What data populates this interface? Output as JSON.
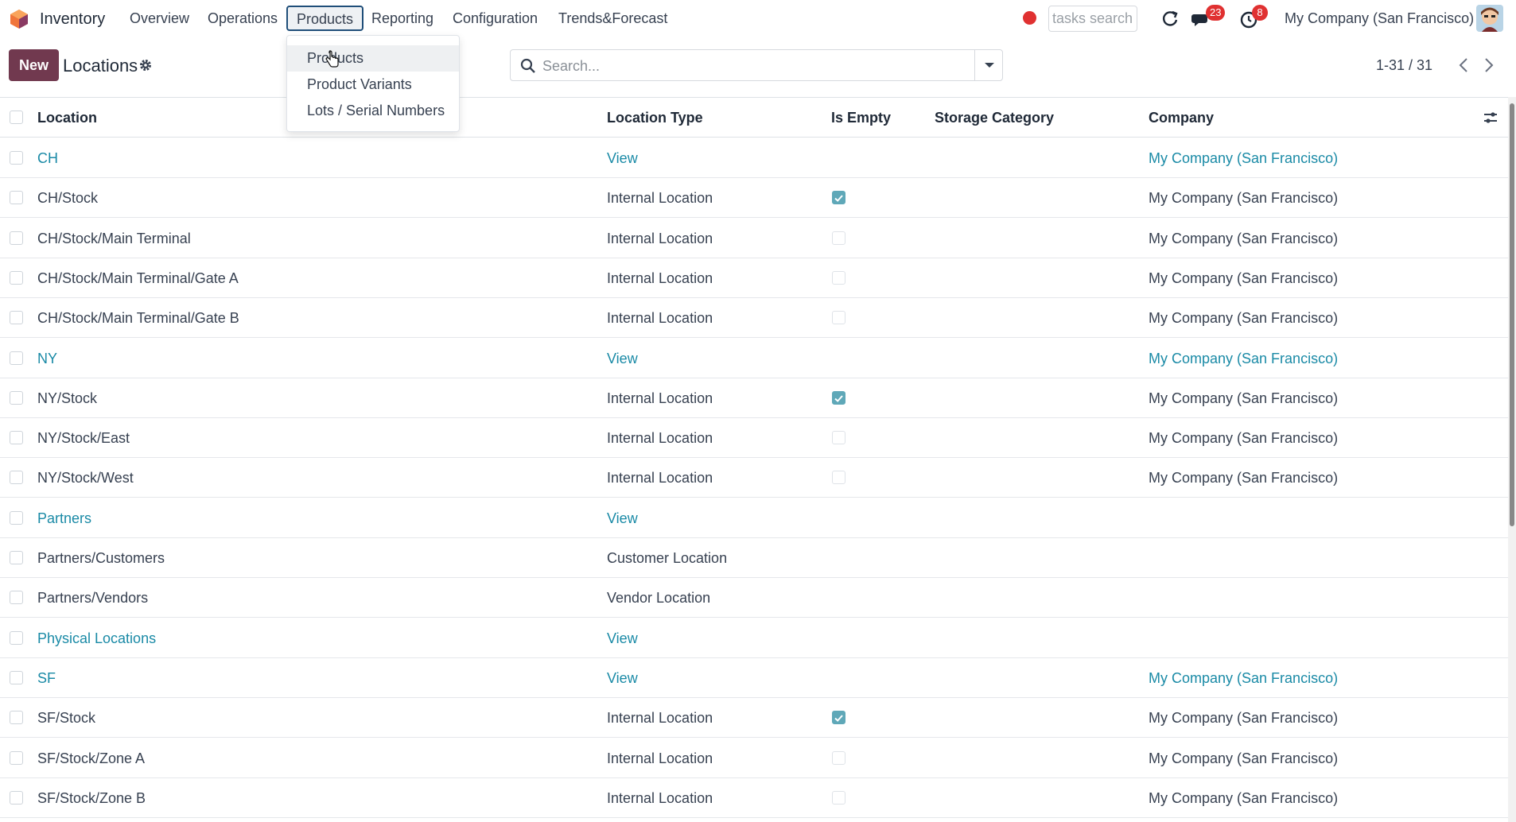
{
  "navbar": {
    "app_name": "Inventory",
    "menus": [
      "Overview",
      "Operations",
      "Products",
      "Reporting",
      "Configuration",
      "Trends&Forecast"
    ],
    "active_menu": "Products",
    "tasks_search_placeholder": "tasks search",
    "messages_badge": "23",
    "activities_badge": "8",
    "company": "My Company (San Francisco)"
  },
  "control_panel": {
    "new_label": "New",
    "title": "Locations",
    "search_placeholder": "Search...",
    "pager": "1-31 / 31"
  },
  "dropdown": {
    "items": [
      "Products",
      "Product Variants",
      "Lots / Serial Numbers"
    ],
    "hovered": "Products"
  },
  "table": {
    "columns": [
      "Location",
      "Location Type",
      "Is Empty",
      "Storage Category",
      "Company"
    ],
    "rows": [
      {
        "location": "CH",
        "type": "View",
        "is_empty": null,
        "storage": "",
        "company": "My Company (San Francisco)",
        "view": true
      },
      {
        "location": "CH/Stock",
        "type": "Internal Location",
        "is_empty": true,
        "storage": "",
        "company": "My Company (San Francisco)",
        "view": false
      },
      {
        "location": "CH/Stock/Main Terminal",
        "type": "Internal Location",
        "is_empty": false,
        "storage": "",
        "company": "My Company (San Francisco)",
        "view": false
      },
      {
        "location": "CH/Stock/Main Terminal/Gate A",
        "type": "Internal Location",
        "is_empty": false,
        "storage": "",
        "company": "My Company (San Francisco)",
        "view": false
      },
      {
        "location": "CH/Stock/Main Terminal/Gate B",
        "type": "Internal Location",
        "is_empty": false,
        "storage": "",
        "company": "My Company (San Francisco)",
        "view": false
      },
      {
        "location": "NY",
        "type": "View",
        "is_empty": null,
        "storage": "",
        "company": "My Company (San Francisco)",
        "view": true
      },
      {
        "location": "NY/Stock",
        "type": "Internal Location",
        "is_empty": true,
        "storage": "",
        "company": "My Company (San Francisco)",
        "view": false
      },
      {
        "location": "NY/Stock/East",
        "type": "Internal Location",
        "is_empty": false,
        "storage": "",
        "company": "My Company (San Francisco)",
        "view": false
      },
      {
        "location": "NY/Stock/West",
        "type": "Internal Location",
        "is_empty": false,
        "storage": "",
        "company": "My Company (San Francisco)",
        "view": false
      },
      {
        "location": "Partners",
        "type": "View",
        "is_empty": null,
        "storage": "",
        "company": "",
        "view": true
      },
      {
        "location": "Partners/Customers",
        "type": "Customer Location",
        "is_empty": null,
        "storage": "",
        "company": "",
        "view": false
      },
      {
        "location": "Partners/Vendors",
        "type": "Vendor Location",
        "is_empty": null,
        "storage": "",
        "company": "",
        "view": false
      },
      {
        "location": "Physical Locations",
        "type": "View",
        "is_empty": null,
        "storage": "",
        "company": "",
        "view": true
      },
      {
        "location": "SF",
        "type": "View",
        "is_empty": null,
        "storage": "",
        "company": "My Company (San Francisco)",
        "view": true
      },
      {
        "location": "SF/Stock",
        "type": "Internal Location",
        "is_empty": true,
        "storage": "",
        "company": "My Company (San Francisco)",
        "view": false
      },
      {
        "location": "SF/Stock/Zone A",
        "type": "Internal Location",
        "is_empty": false,
        "storage": "",
        "company": "My Company (San Francisco)",
        "view": false
      },
      {
        "location": "SF/Stock/Zone B",
        "type": "Internal Location",
        "is_empty": false,
        "storage": "",
        "company": "My Company (San Francisco)",
        "view": false
      }
    ]
  },
  "colors": {
    "brand": "#71394f",
    "link": "#1a8aa6",
    "badge": "#e03131"
  }
}
